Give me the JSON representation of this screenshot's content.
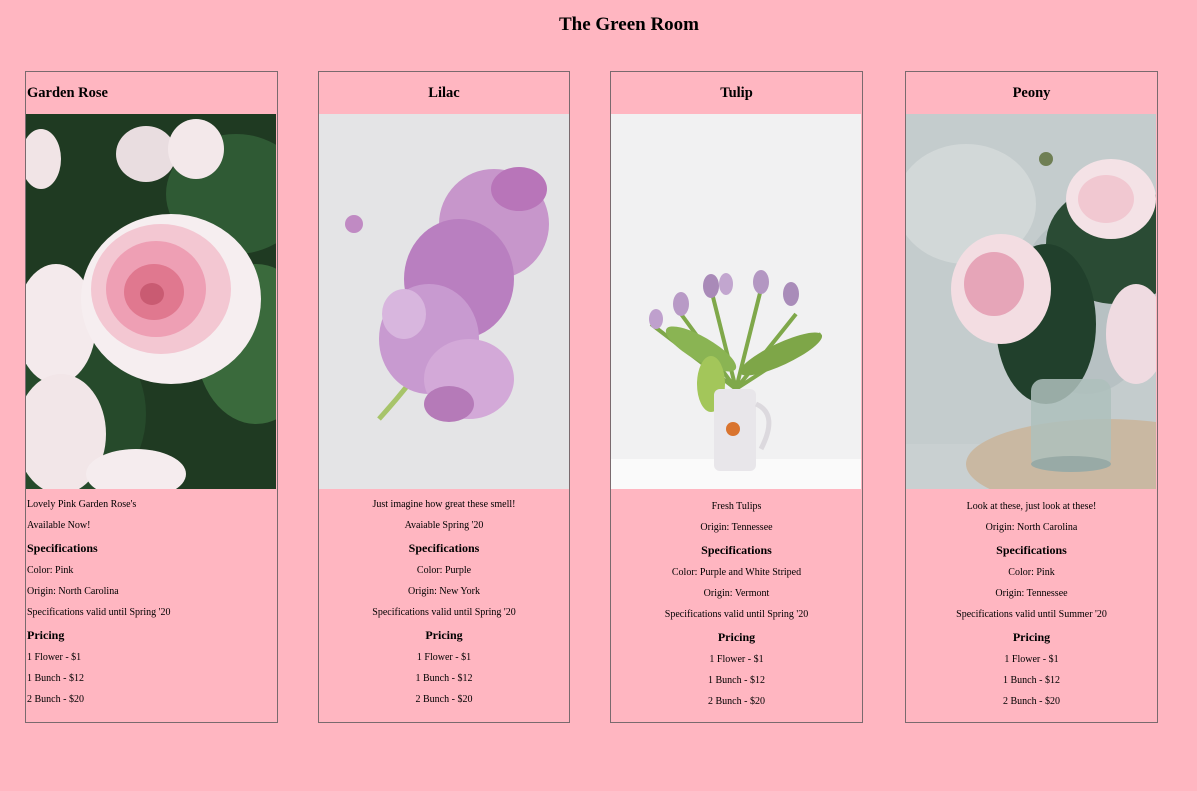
{
  "page": {
    "title": "The Green Room"
  },
  "cards": [
    {
      "name": "Garden Rose",
      "description": "Lovely Pink Garden Rose's",
      "availability": "Available Now!",
      "spec_heading": "Specifications",
      "color": "Color: Pink",
      "origin": "Origin: North Carolina",
      "valid": "Specifications valid until Spring '20",
      "pricing_heading": "Pricing",
      "prices": [
        "1 Flower - $1",
        "1 Bunch - $12",
        "2 Bunch - $20"
      ]
    },
    {
      "name": "Lilac",
      "description": "Just imagine how great these smell!",
      "availability": "Avaiable Spring '20",
      "spec_heading": "Specifications",
      "color": "Color: Purple",
      "origin": "Origin: New York",
      "valid": "Specifications valid until Spring '20",
      "pricing_heading": "Pricing",
      "prices": [
        "1 Flower - $1",
        "1 Bunch - $12",
        "2 Bunch - $20"
      ]
    },
    {
      "name": "Tulip",
      "description": "Fresh Tulips",
      "availability": "Origin: Tennessee",
      "spec_heading": "Specifications",
      "color": "Color: Purple and White Striped",
      "origin": "Origin: Vermont",
      "valid": "Specifications valid until Spring '20",
      "pricing_heading": "Pricing",
      "prices": [
        "1 Flower - $1",
        "1 Bunch - $12",
        "2 Bunch - $20"
      ]
    },
    {
      "name": "Peony",
      "description": "Look at these, just look at these!",
      "availability": "Origin: North Carolina",
      "spec_heading": "Specifications",
      "color": "Color: Pink",
      "origin": "Origin: Tennessee",
      "valid": "Specifications valid until Summer '20",
      "pricing_heading": "Pricing",
      "prices": [
        "1 Flower - $1",
        "1 Bunch - $12",
        "2 Bunch - $20"
      ]
    }
  ]
}
